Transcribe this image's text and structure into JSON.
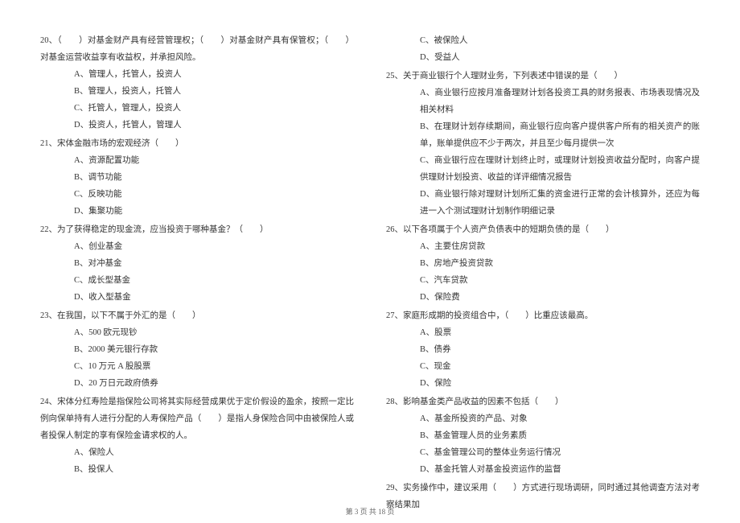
{
  "left": {
    "q20": {
      "text": "20、（　　）对基金财产具有经营管理权；（　　）对基金财产具有保管权；（　　）对基金运营收益享有收益权，并承担风险。",
      "a": "A、管理人，托管人，投资人",
      "b": "B、管理人，投资人，托管人",
      "c": "C、托管人，管理人，投资人",
      "d": "D、投资人，托管人，管理人"
    },
    "q21": {
      "text": "21、宋体金融市场的宏观经济（　　）",
      "a": "A、资源配置功能",
      "b": "B、调节功能",
      "c": "C、反映功能",
      "d": "D、集聚功能"
    },
    "q22": {
      "text": "22、为了获得稳定的现金流，应当投资于哪种基金？（　　）",
      "a": "A、创业基金",
      "b": "B、对冲基金",
      "c": "C、成长型基金",
      "d": "D、收入型基金"
    },
    "q23": {
      "text": "23、在我国，以下不属于外汇的是（　　）",
      "a": "A、500 欧元现钞",
      "b": "B、2000 美元银行存款",
      "c": "C、10 万元 A 股股票",
      "d": "D、20 万日元政府债券"
    },
    "q24": {
      "text": "24、宋体分红寿险是指保险公司将其实际经营成果优于定价假设的盈余，按照一定比例向保单持有人进行分配的人寿保险产品（　　）是指人身保险合同中由被保险人或者投保人制定的享有保险金请求权的人。",
      "a": "A、保险人",
      "b": "B、投保人"
    }
  },
  "right": {
    "q24cont": {
      "c": "C、被保险人",
      "d": "D、受益人"
    },
    "q25": {
      "text": "25、关于商业银行个人理财业务，下列表述中错误的是（　　）",
      "a": "A、商业银行应按月准备理财计划各投资工具的财务报表、市场表现情况及相关材料",
      "b": "B、在理财计划存续期间，商业银行应向客户提供客户所有的相关资产的账单，账单提供应不少于两次，并且至少每月提供一次",
      "c": "C、商业银行应在理财计划终止时，或理财计划投资收益分配时，向客户提供理财计划投资、收益的详评细情况报告",
      "d": "D、商业银行除对理财计划所汇集的资金进行正常的会计核算外，还应为每进一入个测试理财计划制作明细记录"
    },
    "q26": {
      "text": "26、以下各项属于个人资产负债表中的短期负债的是（　　）",
      "a": "A、主要住房贷款",
      "b": "B、房地产投资贷款",
      "c": "C、汽车贷款",
      "d": "D、保险费"
    },
    "q27": {
      "text": "27、家庭形成期的投资组合中，（　　）比重应该最高。",
      "a": "A、股票",
      "b": "B、债券",
      "c": "C、现金",
      "d": "D、保险"
    },
    "q28": {
      "text": "28、影响基金类产品收益的因素不包括（　　）",
      "a": "A、基金所投资的产品、对象",
      "b": "B、基金管理人员的业务素质",
      "c": "C、基金管理公司的整体业务运行情况",
      "d": "D、基金托管人对基金投资运作的监督"
    },
    "q29": {
      "text": "29、实务操作中，建议采用（　　）方式进行现场调研，同时通过其他调查方法对考察结果加"
    }
  },
  "footer": "第 3 页 共 18 页"
}
